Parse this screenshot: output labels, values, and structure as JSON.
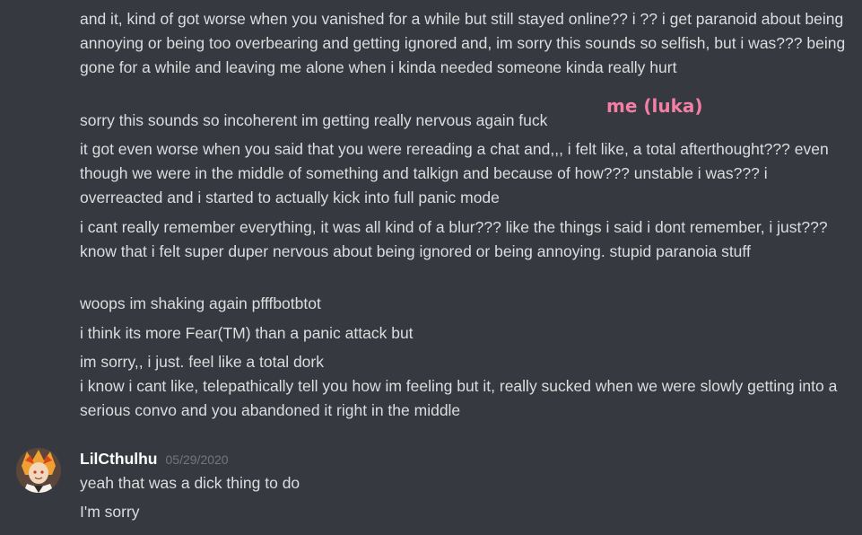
{
  "annotation": "me (luka)",
  "messages_top": [
    "and it, kind of got worse when you vanished for a while but still stayed online?? i ?? i get paranoid about being annoying or being too overbearing and getting ignored and, im sorry this sounds so selfish, but i was??? being gone for a while and leaving me alone when i kinda needed someone kinda really hurt",
    "sorry this sounds so incoherent im getting really nervous again fuck",
    "it got even worse when you said that you were rereading a chat and,,, i felt like, a total afterthought??? even though we were in the middle of something and talkign and because of how??? unstable i was??? i overreacted and i started to actually kick into full panic mode",
    "i cant really remember everything, it was all kind of a blur??? like the things i said i dont remember, i just??? know that i felt super duper nervous about being ignored or being annoying. stupid paranoia stuff",
    "woops im shaking again pfffbotbtot",
    "i think its more Fear(TM) than a panic attack but",
    "im sorry,, i just. feel like a total dork",
    "i know i cant like, telepathically tell you how im feeling but it, really sucked when we were slowly getting into a serious convo and you abandoned it right in the middle"
  ],
  "reply": {
    "username": "LilCthulhu",
    "timestamp": "05/29/2020",
    "messages": [
      "yeah that was a dick thing to do",
      "I'm sorry"
    ]
  },
  "colors": {
    "background": "#36393f",
    "text": "#dcddde",
    "annotation": "#f47fa5",
    "timestamp": "#72767d"
  }
}
